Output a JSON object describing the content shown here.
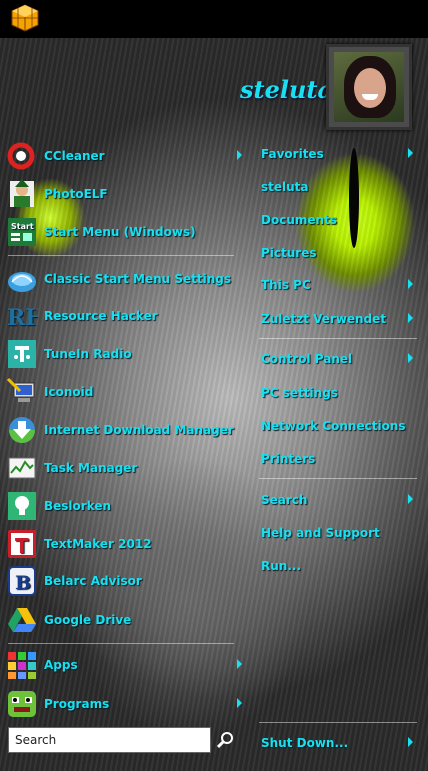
{
  "user": {
    "name": "steluta"
  },
  "left_items": [
    {
      "label": "CCleaner",
      "icon": "ccleaner-icon",
      "has_arrow": true
    },
    {
      "label": "PhotoELF",
      "icon": "photoelf-icon",
      "has_arrow": false
    },
    {
      "label": "Start Menu (Windows)",
      "icon": "start-menu-icon",
      "has_arrow": false
    },
    {
      "label": "Classic Start Menu Settings",
      "icon": "shell-icon",
      "has_arrow": false
    },
    {
      "label": "Resource Hacker",
      "icon": "rh-icon",
      "has_arrow": false
    },
    {
      "label": "TuneIn Radio",
      "icon": "tunein-icon",
      "has_arrow": false
    },
    {
      "label": "Iconoid",
      "icon": "iconoid-icon",
      "has_arrow": false
    },
    {
      "label": "Internet Download Manager",
      "icon": "idm-icon",
      "has_arrow": false
    },
    {
      "label": "Task Manager",
      "icon": "task-manager-icon",
      "has_arrow": false
    },
    {
      "label": "Beslorken",
      "icon": "lightbulb-icon",
      "has_arrow": false
    },
    {
      "label": "TextMaker 2012",
      "icon": "textmaker-icon",
      "has_arrow": false
    },
    {
      "label": "Belarc Advisor",
      "icon": "belarc-icon",
      "has_arrow": false
    },
    {
      "label": "Google Drive",
      "icon": "google-drive-icon",
      "has_arrow": false
    },
    {
      "label": "Apps",
      "icon": "apps-icon",
      "has_arrow": true
    },
    {
      "label": "Programs",
      "icon": "programs-icon",
      "has_arrow": true
    }
  ],
  "right_items": [
    {
      "label": "Favorites",
      "has_arrow": true
    },
    {
      "label": "steluta",
      "has_arrow": false
    },
    {
      "label": "Documents",
      "has_arrow": false
    },
    {
      "label": "Pictures",
      "has_arrow": false
    },
    {
      "label": "This PC",
      "has_arrow": true
    },
    {
      "label": "Zuletzt Verwendet",
      "has_arrow": true
    },
    {
      "label": "Control Panel",
      "has_arrow": true
    },
    {
      "label": "PC settings",
      "has_arrow": false
    },
    {
      "label": "Network Connections",
      "has_arrow": false
    },
    {
      "label": "Printers",
      "has_arrow": false
    },
    {
      "label": "Search",
      "has_arrow": true
    },
    {
      "label": "Help and Support",
      "has_arrow": false
    },
    {
      "label": "Run...",
      "has_arrow": false
    }
  ],
  "shutdown": {
    "label": "Shut Down...",
    "has_arrow": true
  },
  "search": {
    "placeholder": "Search",
    "value": ""
  },
  "colors": {
    "text": "#19e0f0",
    "topbar": "#000000",
    "eye": "#b9f000"
  }
}
